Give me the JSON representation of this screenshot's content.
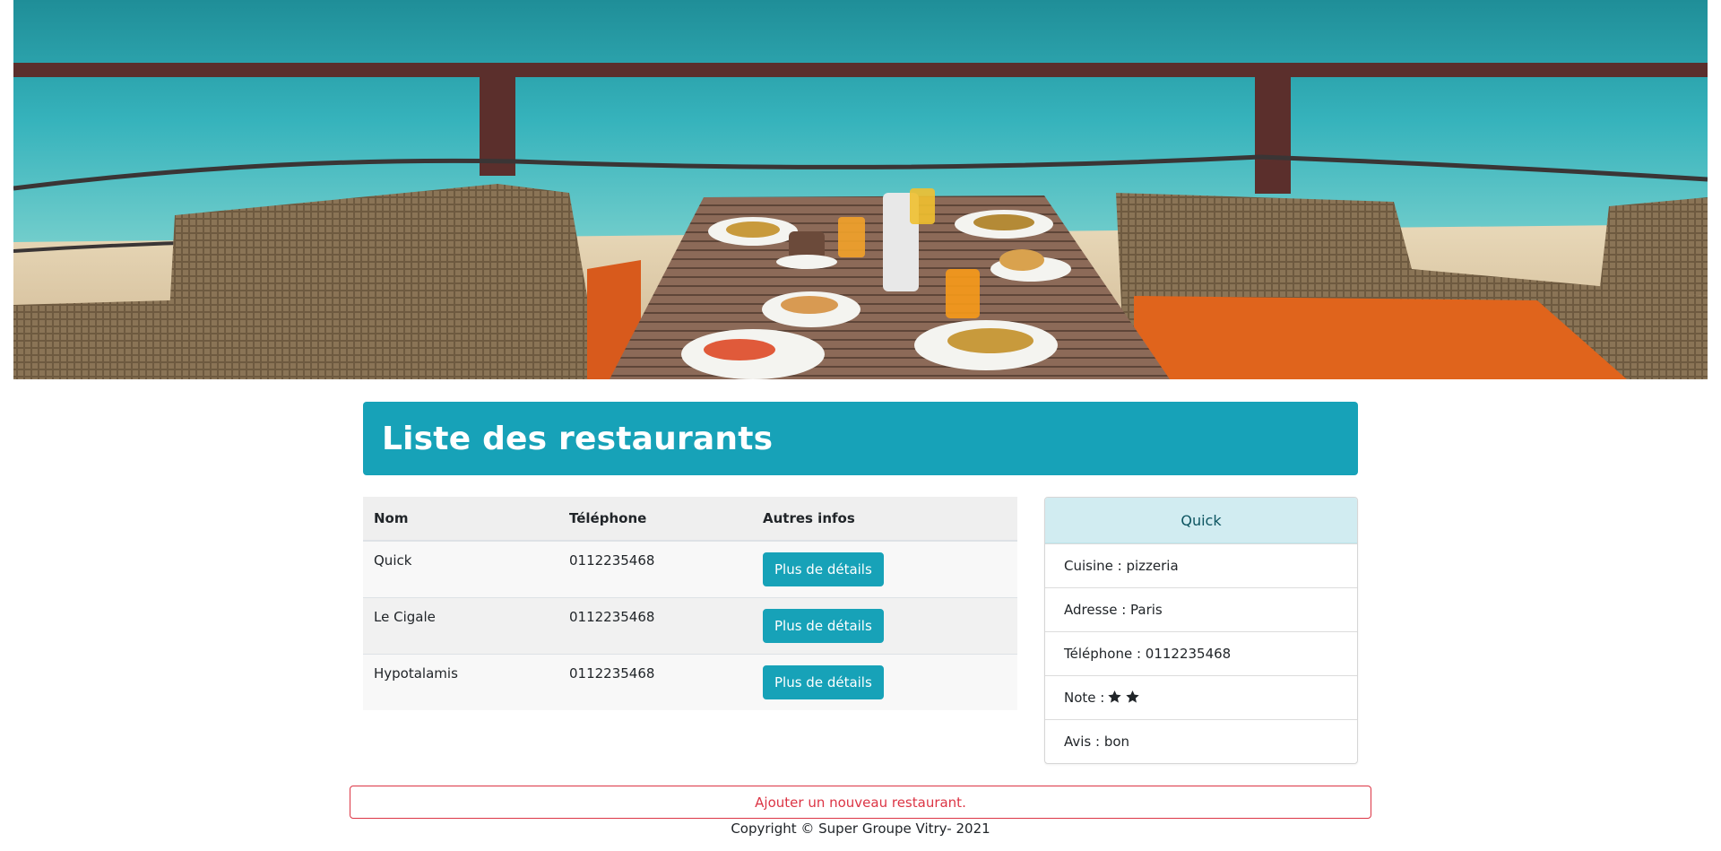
{
  "hero": {
    "alt": "Table de petit-déjeuner face à la mer"
  },
  "title": "Liste des restaurants",
  "table": {
    "headers": [
      "Nom",
      "Téléphone",
      "Autres infos"
    ],
    "rows": [
      {
        "name": "Quick",
        "phone": "0112235468",
        "button": "Plus de détails"
      },
      {
        "name": "Le Cigale",
        "phone": "0112235468",
        "button": "Plus de détails"
      },
      {
        "name": "Hypotalamis",
        "phone": "0112235468",
        "button": "Plus de détails"
      }
    ]
  },
  "details": {
    "name": "Quick",
    "cuisine": "Cuisine : pizzeria",
    "address": "Adresse : Paris",
    "phone": "Téléphone : 0112235468",
    "note_label": "Note :",
    "note_stars": 2,
    "review": "Avis : bon"
  },
  "add_button": "Ajouter un nouveau restaurant.",
  "footer": "Copyright © Super Groupe Vitry- 2021",
  "colors": {
    "primary": "#17a2b8",
    "danger": "#dc3545",
    "card_header_bg": "#d1ecf1",
    "card_header_text": "#0c5460"
  }
}
